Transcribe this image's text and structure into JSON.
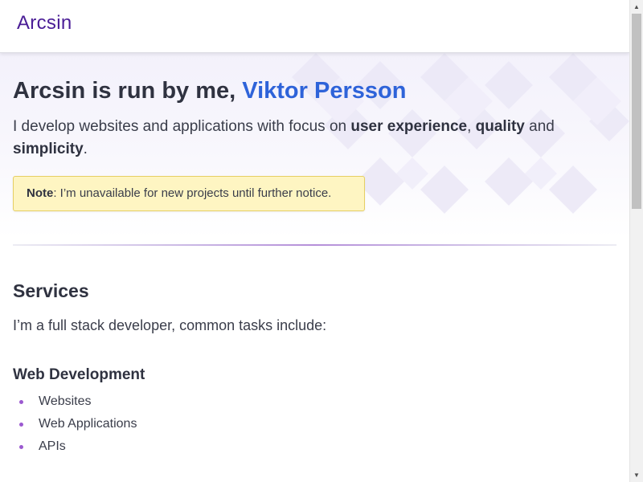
{
  "header": {
    "logo_text": "Arcsin"
  },
  "hero": {
    "title_prefix": "Arcsin is run by me, ",
    "name": "Viktor Persson",
    "desc_part1": "I develop websites and applications with focus on ",
    "desc_bold1": "user experience",
    "desc_sep1": ", ",
    "desc_bold2": "quality",
    "desc_sep2": " and ",
    "desc_bold3": "simplicity",
    "desc_end": ".",
    "note_label": "Note",
    "note_text": ": I’m unavailable for new projects until further notice."
  },
  "services": {
    "title": "Services",
    "intro": "I’m a full stack developer, common tasks include:",
    "web_dev": {
      "title": "Web Development",
      "items": [
        "Websites",
        "Web Applications",
        "APIs"
      ]
    }
  },
  "colors": {
    "brand": "#4a1d96",
    "link": "#2e63d9",
    "note_bg": "#fef5c2",
    "bullet": "#9b59d0"
  },
  "scrollbar": {
    "up_icon": "arrow-up-icon",
    "down_icon": "arrow-down-icon"
  }
}
